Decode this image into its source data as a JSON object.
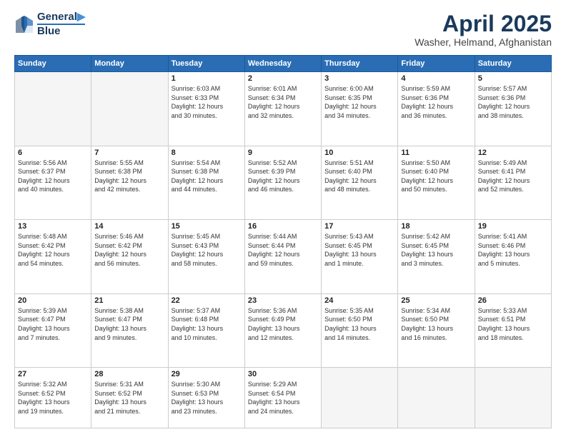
{
  "header": {
    "logo_line1": "General",
    "logo_line2": "Blue",
    "month": "April 2025",
    "location": "Washer, Helmand, Afghanistan"
  },
  "weekdays": [
    "Sunday",
    "Monday",
    "Tuesday",
    "Wednesday",
    "Thursday",
    "Friday",
    "Saturday"
  ],
  "weeks": [
    [
      {
        "day": "",
        "info": ""
      },
      {
        "day": "",
        "info": ""
      },
      {
        "day": "1",
        "info": "Sunrise: 6:03 AM\nSunset: 6:33 PM\nDaylight: 12 hours\nand 30 minutes."
      },
      {
        "day": "2",
        "info": "Sunrise: 6:01 AM\nSunset: 6:34 PM\nDaylight: 12 hours\nand 32 minutes."
      },
      {
        "day": "3",
        "info": "Sunrise: 6:00 AM\nSunset: 6:35 PM\nDaylight: 12 hours\nand 34 minutes."
      },
      {
        "day": "4",
        "info": "Sunrise: 5:59 AM\nSunset: 6:36 PM\nDaylight: 12 hours\nand 36 minutes."
      },
      {
        "day": "5",
        "info": "Sunrise: 5:57 AM\nSunset: 6:36 PM\nDaylight: 12 hours\nand 38 minutes."
      }
    ],
    [
      {
        "day": "6",
        "info": "Sunrise: 5:56 AM\nSunset: 6:37 PM\nDaylight: 12 hours\nand 40 minutes."
      },
      {
        "day": "7",
        "info": "Sunrise: 5:55 AM\nSunset: 6:38 PM\nDaylight: 12 hours\nand 42 minutes."
      },
      {
        "day": "8",
        "info": "Sunrise: 5:54 AM\nSunset: 6:38 PM\nDaylight: 12 hours\nand 44 minutes."
      },
      {
        "day": "9",
        "info": "Sunrise: 5:52 AM\nSunset: 6:39 PM\nDaylight: 12 hours\nand 46 minutes."
      },
      {
        "day": "10",
        "info": "Sunrise: 5:51 AM\nSunset: 6:40 PM\nDaylight: 12 hours\nand 48 minutes."
      },
      {
        "day": "11",
        "info": "Sunrise: 5:50 AM\nSunset: 6:40 PM\nDaylight: 12 hours\nand 50 minutes."
      },
      {
        "day": "12",
        "info": "Sunrise: 5:49 AM\nSunset: 6:41 PM\nDaylight: 12 hours\nand 52 minutes."
      }
    ],
    [
      {
        "day": "13",
        "info": "Sunrise: 5:48 AM\nSunset: 6:42 PM\nDaylight: 12 hours\nand 54 minutes."
      },
      {
        "day": "14",
        "info": "Sunrise: 5:46 AM\nSunset: 6:42 PM\nDaylight: 12 hours\nand 56 minutes."
      },
      {
        "day": "15",
        "info": "Sunrise: 5:45 AM\nSunset: 6:43 PM\nDaylight: 12 hours\nand 58 minutes."
      },
      {
        "day": "16",
        "info": "Sunrise: 5:44 AM\nSunset: 6:44 PM\nDaylight: 12 hours\nand 59 minutes."
      },
      {
        "day": "17",
        "info": "Sunrise: 5:43 AM\nSunset: 6:45 PM\nDaylight: 13 hours\nand 1 minute."
      },
      {
        "day": "18",
        "info": "Sunrise: 5:42 AM\nSunset: 6:45 PM\nDaylight: 13 hours\nand 3 minutes."
      },
      {
        "day": "19",
        "info": "Sunrise: 5:41 AM\nSunset: 6:46 PM\nDaylight: 13 hours\nand 5 minutes."
      }
    ],
    [
      {
        "day": "20",
        "info": "Sunrise: 5:39 AM\nSunset: 6:47 PM\nDaylight: 13 hours\nand 7 minutes."
      },
      {
        "day": "21",
        "info": "Sunrise: 5:38 AM\nSunset: 6:47 PM\nDaylight: 13 hours\nand 9 minutes."
      },
      {
        "day": "22",
        "info": "Sunrise: 5:37 AM\nSunset: 6:48 PM\nDaylight: 13 hours\nand 10 minutes."
      },
      {
        "day": "23",
        "info": "Sunrise: 5:36 AM\nSunset: 6:49 PM\nDaylight: 13 hours\nand 12 minutes."
      },
      {
        "day": "24",
        "info": "Sunrise: 5:35 AM\nSunset: 6:50 PM\nDaylight: 13 hours\nand 14 minutes."
      },
      {
        "day": "25",
        "info": "Sunrise: 5:34 AM\nSunset: 6:50 PM\nDaylight: 13 hours\nand 16 minutes."
      },
      {
        "day": "26",
        "info": "Sunrise: 5:33 AM\nSunset: 6:51 PM\nDaylight: 13 hours\nand 18 minutes."
      }
    ],
    [
      {
        "day": "27",
        "info": "Sunrise: 5:32 AM\nSunset: 6:52 PM\nDaylight: 13 hours\nand 19 minutes."
      },
      {
        "day": "28",
        "info": "Sunrise: 5:31 AM\nSunset: 6:52 PM\nDaylight: 13 hours\nand 21 minutes."
      },
      {
        "day": "29",
        "info": "Sunrise: 5:30 AM\nSunset: 6:53 PM\nDaylight: 13 hours\nand 23 minutes."
      },
      {
        "day": "30",
        "info": "Sunrise: 5:29 AM\nSunset: 6:54 PM\nDaylight: 13 hours\nand 24 minutes."
      },
      {
        "day": "",
        "info": ""
      },
      {
        "day": "",
        "info": ""
      },
      {
        "day": "",
        "info": ""
      }
    ]
  ]
}
